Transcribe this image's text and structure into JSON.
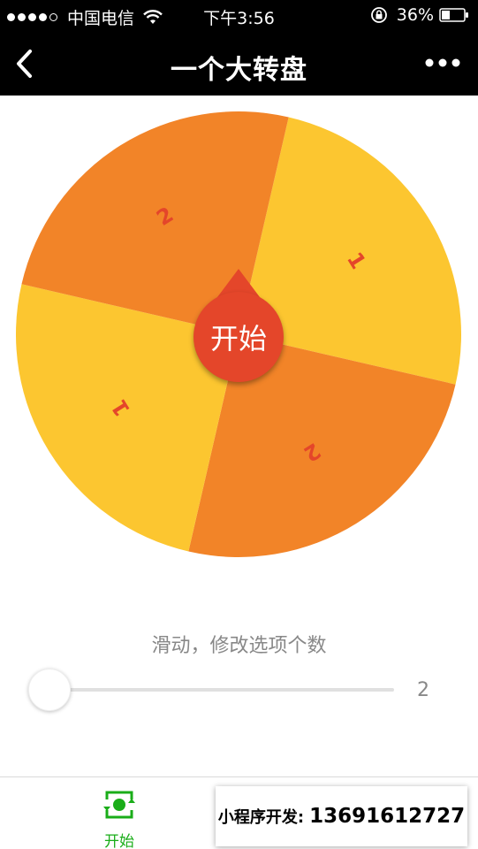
{
  "status_bar": {
    "carrier": "中国电信",
    "time": "下午3:56",
    "battery": "36%",
    "icons": [
      "signal-dots",
      "wifi-icon",
      "rotation-lock-icon",
      "battery-icon"
    ]
  },
  "nav": {
    "title": "一个大转盘",
    "icons": [
      "back-chevron-icon",
      "more-dots-icon"
    ]
  },
  "wheel": {
    "start_label": "开始",
    "segments": [
      {
        "label": "1",
        "color": "#fcc630"
      },
      {
        "label": "2",
        "color": "#f28428"
      },
      {
        "label": "1",
        "color": "#fcc630"
      },
      {
        "label": "2",
        "color": "#f28428"
      }
    ],
    "label_color": "#e4462a",
    "button_color": "#e4462a"
  },
  "slider": {
    "label": "滑动，修改选项个数",
    "value": "2"
  },
  "tab_bar": {
    "items": [
      {
        "label": "开始",
        "icon": "spin-refresh-icon",
        "active": true
      },
      {
        "label": "",
        "icon": "",
        "active": false
      }
    ],
    "active_color": "#1aad19"
  },
  "watermark": {
    "label": "小程序开发:",
    "phone": "13691612727"
  }
}
